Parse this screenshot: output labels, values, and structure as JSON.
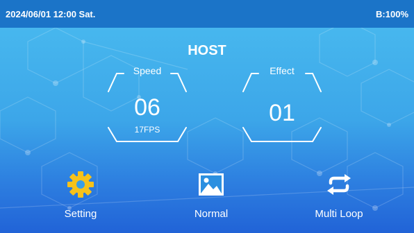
{
  "status_bar": {
    "datetime": "2024/06/01 12:00 Sat.",
    "battery": "B:100%"
  },
  "title": "HOST",
  "speed": {
    "label": "Speed",
    "value": "06",
    "fps": "17FPS"
  },
  "effect": {
    "label": "Effect",
    "value": "01"
  },
  "menu": {
    "setting": {
      "label": "Setting",
      "icon": "gear-icon"
    },
    "normal": {
      "label": "Normal",
      "icon": "picture-icon"
    },
    "multi_loop": {
      "label": "Multi Loop",
      "icon": "loop-arrows-icon"
    }
  },
  "colors": {
    "status_bar": "#1b74c8",
    "gear_yellow": "#f7c21a",
    "text": "#ffffff"
  }
}
